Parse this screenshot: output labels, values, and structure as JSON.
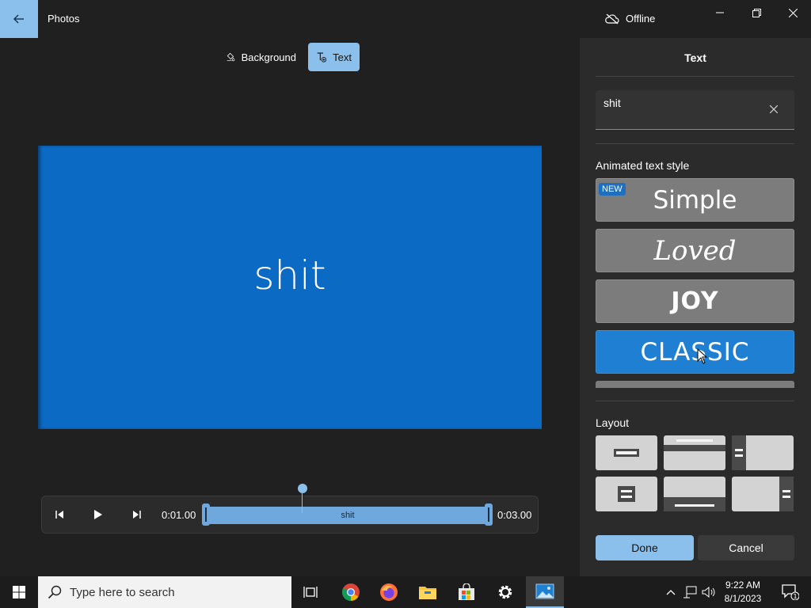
{
  "app": {
    "title": "Photos",
    "status": "Offline"
  },
  "toolbar": {
    "background_label": "Background",
    "text_label": "Text"
  },
  "preview": {
    "text": "shit",
    "bg_color": "#0b6ac4"
  },
  "timeline": {
    "start_time": "0:01.00",
    "end_time": "0:03.00",
    "clip_label": "shit"
  },
  "panel": {
    "title": "Text",
    "input_value": "shit",
    "animated_style_label": "Animated text style",
    "styles": [
      {
        "label": "Simple",
        "badge": "NEW"
      },
      {
        "label": "Loved"
      },
      {
        "label": "JOY"
      },
      {
        "label": "CLASSIC",
        "selected": true
      }
    ],
    "layout_label": "Layout",
    "done_label": "Done",
    "cancel_label": "Cancel"
  },
  "taskbar": {
    "search_placeholder": "Type here to search",
    "time": "9:22 AM",
    "date": "8/1/2023",
    "notification_count": "1"
  },
  "colors": {
    "accent": "#8cc0ec",
    "selected_style": "#1f7fd2"
  }
}
